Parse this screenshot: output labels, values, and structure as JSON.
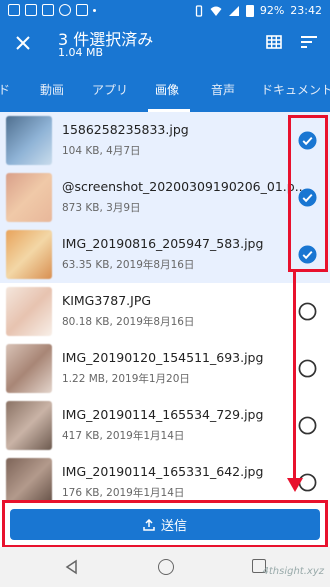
{
  "status_bar": {
    "battery": "92%",
    "time": "23:42"
  },
  "header": {
    "title": "3 件選択済み",
    "subtitle": "1.04 MB"
  },
  "tabs": [
    {
      "label": "ド"
    },
    {
      "label": "動画"
    },
    {
      "label": "アプリ"
    },
    {
      "label": "画像",
      "active": true
    },
    {
      "label": "音声"
    },
    {
      "label": "ドキュメント"
    }
  ],
  "files": [
    {
      "name": "1586258235833.jpg",
      "meta": "104 KB, 4月7日",
      "selected": true
    },
    {
      "name": "@screenshot_20200309190206_01.p...",
      "meta": "873 KB, 3月9日",
      "selected": true
    },
    {
      "name": "IMG_20190816_205947_583.jpg",
      "meta": "63.35 KB, 2019年8月16日",
      "selected": true
    },
    {
      "name": "KIMG3787.JPG",
      "meta": "80.18 KB, 2019年8月16日",
      "selected": false
    },
    {
      "name": "IMG_20190120_154511_693.jpg",
      "meta": "1.22 MB, 2019年1月20日",
      "selected": false
    },
    {
      "name": "IMG_20190114_165534_729.jpg",
      "meta": "417 KB, 2019年1月14日",
      "selected": false
    },
    {
      "name": "IMG_20190114_165331_642.jpg",
      "meta": "176 KB, 2019年1月14日",
      "selected": false
    }
  ],
  "send_button": {
    "label": "送信"
  },
  "watermark": "4thsight.xyz",
  "colors": {
    "primary": "#1976d2",
    "selected_row": "#e8f0fe",
    "annotation": "#e8112d"
  }
}
